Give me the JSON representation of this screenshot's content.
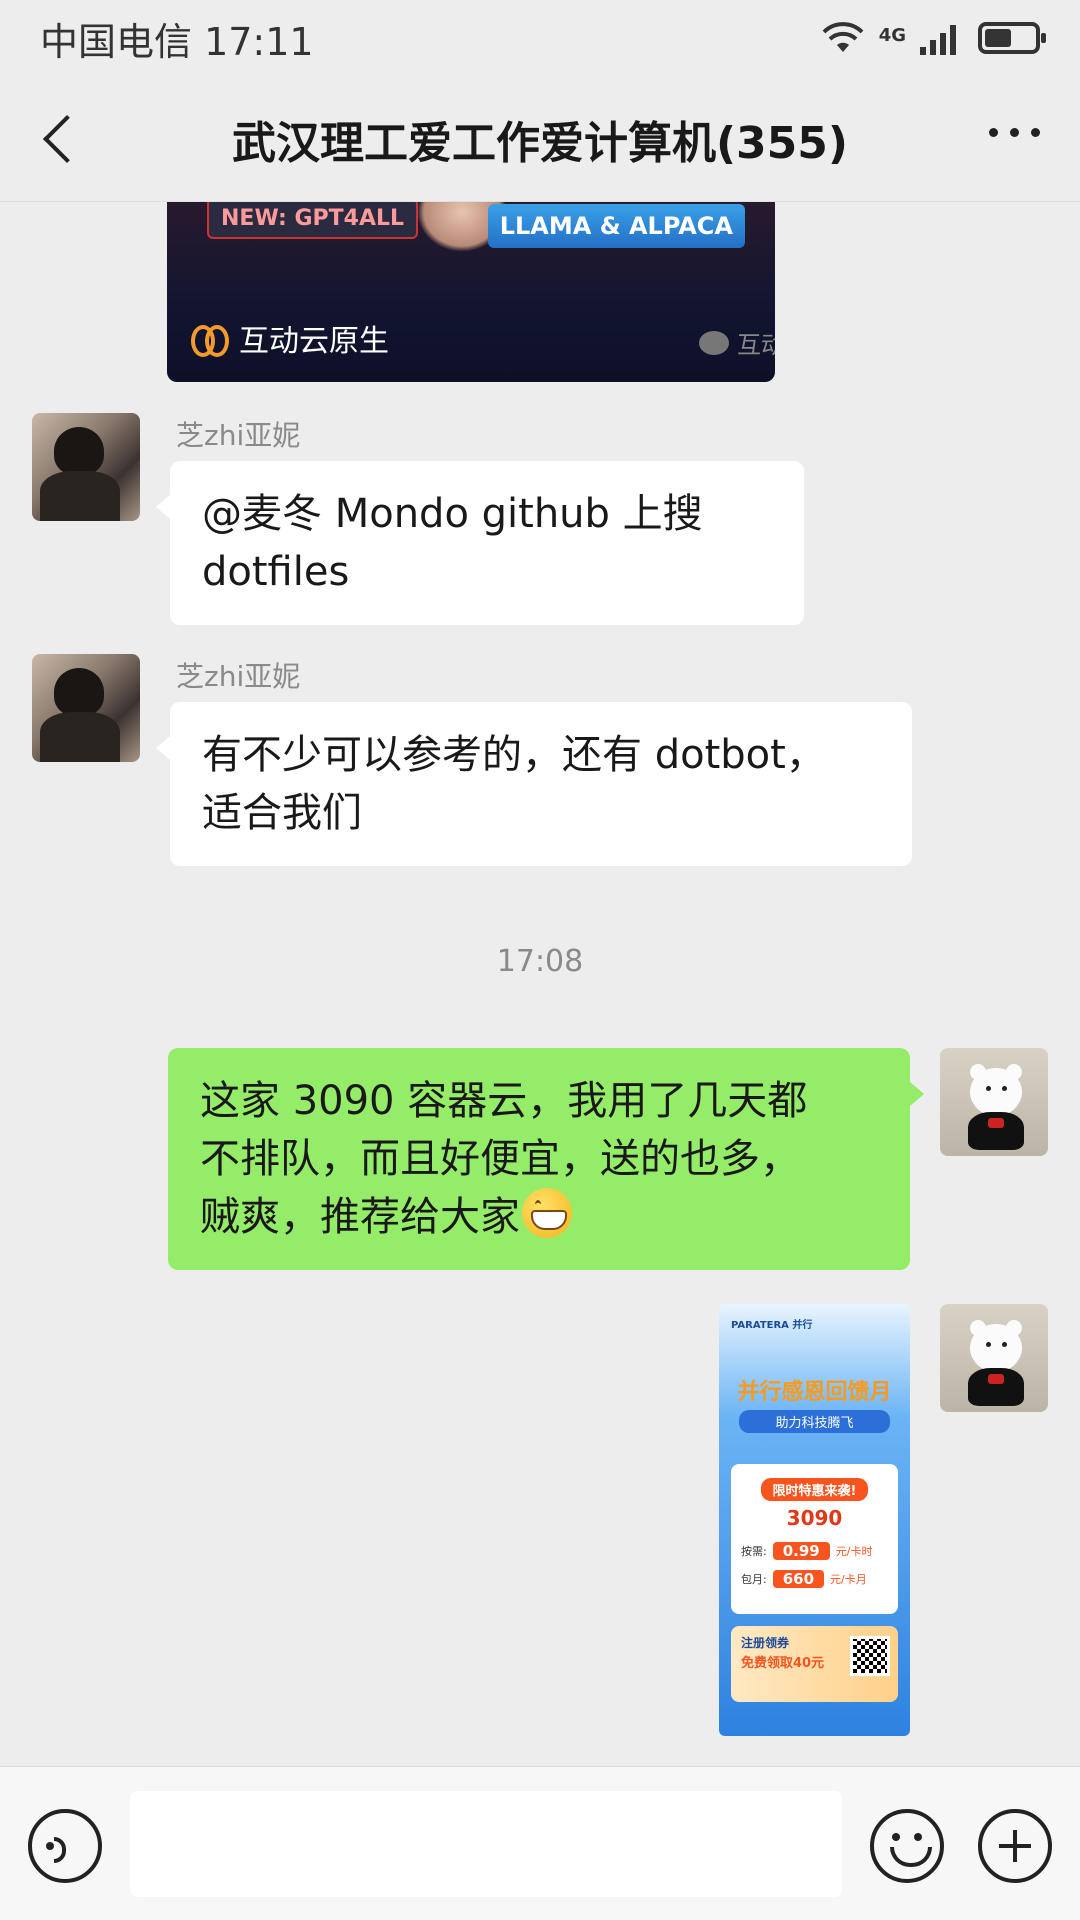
{
  "status_bar": {
    "carrier_time": "中国电信 17:11",
    "network": "4G",
    "icons": [
      "wifi-icon",
      "signal-icon",
      "battery-icon"
    ]
  },
  "nav": {
    "title": "武汉理工爱工作爱计算机(355)",
    "back_icon": "back-arrow-icon",
    "more_icon": "more-dots-icon"
  },
  "card": {
    "tag_left": "NEW: GPT4ALL",
    "tag_right": "LLAMA & ALPACA",
    "source": "互动云原生",
    "wechat_label": "互动"
  },
  "messages": [
    {
      "sender": "芝zhi亚妮",
      "line1": "@麦冬 Mondo  github 上搜",
      "line2": "dotfiles"
    },
    {
      "sender": "芝zhi亚妮",
      "line1": "有不少可以参考的，还有 dotbot，",
      "line2": "适合我们"
    }
  ],
  "time_separator": "17:08",
  "my_message": {
    "line1": "这家 3090 容器云，我用了几天都",
    "line2": "不排队，而且好便宜，送的也多，",
    "line3": "贼爽，推荐给大家"
  },
  "poster": {
    "brand": "PARATERA 并行",
    "title": "并行感恩回馈月",
    "subtitle": "助力科技腾飞",
    "ribbon": "限时特惠来袭!",
    "gpu": "3090",
    "row1_label": "按需:",
    "row1_price": "0.99",
    "row1_unit": "元/卡时",
    "row2_label": "包月:",
    "row2_price": "660",
    "row2_unit": "元/卡月",
    "bottom_title": "注册领券",
    "bottom_offer": "免费领取40元"
  },
  "input_bar": {
    "placeholder": "",
    "icons": [
      "voice-icon",
      "emoji-icon",
      "plus-icon"
    ]
  },
  "colors": {
    "background": "#ededed",
    "my_bubble": "#95ec69",
    "other_bubble": "#ffffff"
  }
}
